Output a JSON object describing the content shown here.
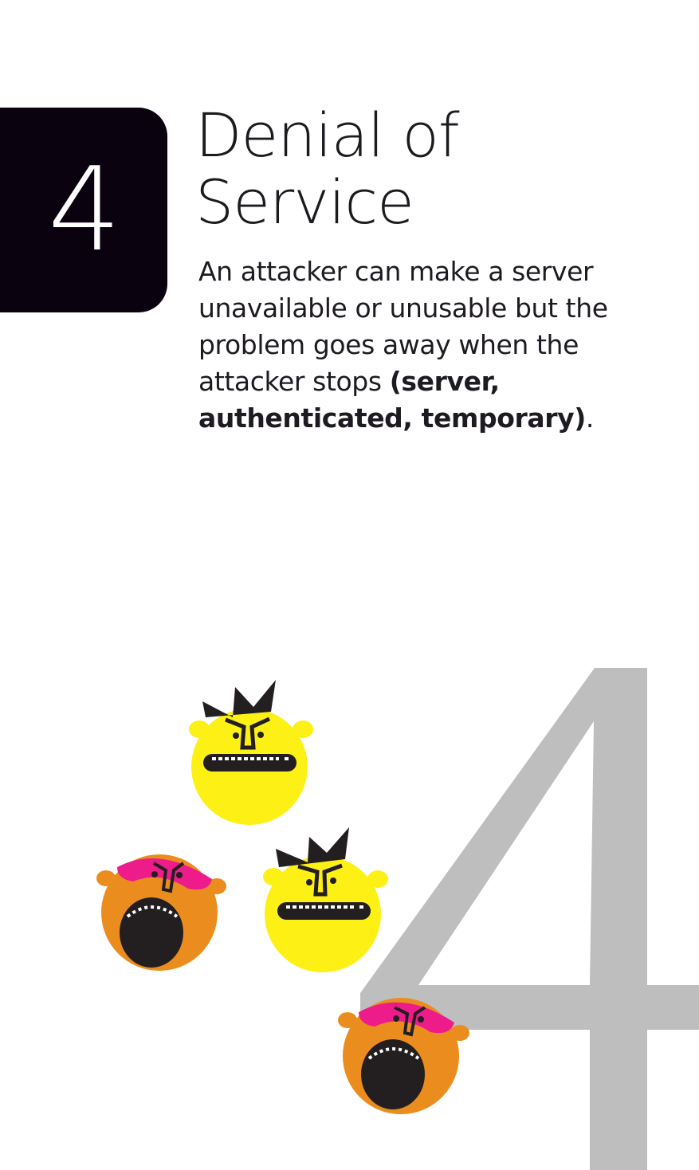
{
  "card": {
    "rank": "4",
    "title_line1": "Denial of",
    "title_line2": "Service",
    "description_plain": "An attacker can make a server unavailable or unusable but the problem goes away when the attacker stops ",
    "description_bold": "(server, authenticated, temporary)",
    "description_end": ".",
    "watermark_digit": "4"
  },
  "colors": {
    "rank_box": "#0b0210",
    "watermark": "#bebebf",
    "yellow_face": "#fcf015",
    "orange_face": "#ea8d1e",
    "pink_mask": "#ee1b8b",
    "dark": "#231f20"
  },
  "illustration": {
    "characters": [
      "crowned-yellow-character",
      "screaming-orange-character",
      "crowned-yellow-character",
      "screaming-orange-character"
    ]
  }
}
